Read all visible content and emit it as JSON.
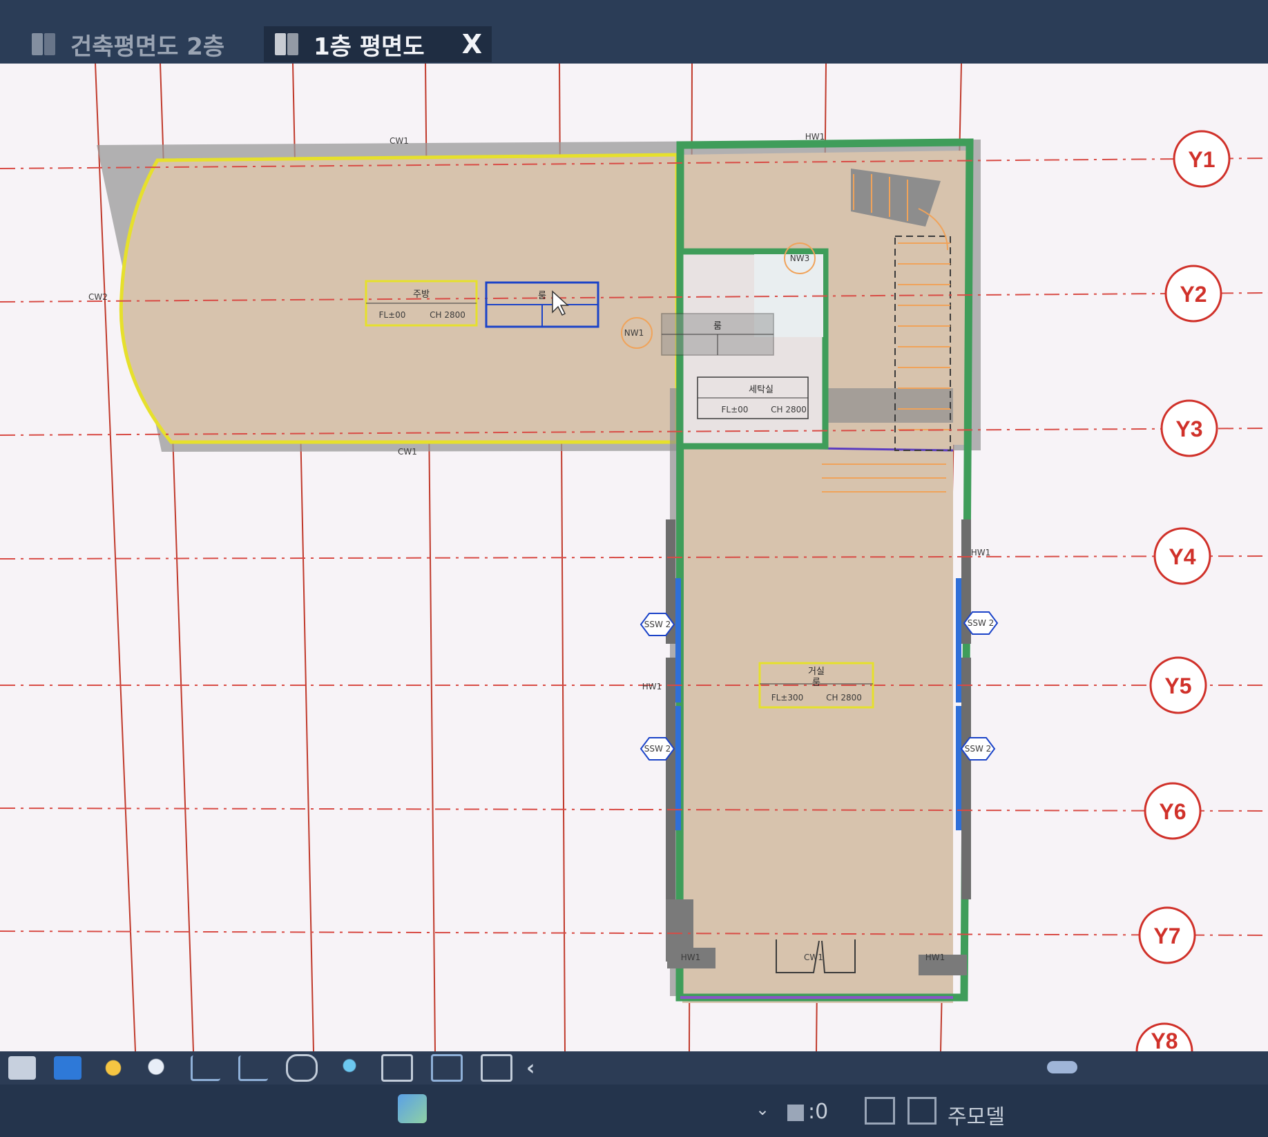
{
  "tabs": [
    {
      "label": "건축평면도 2층",
      "active": false
    },
    {
      "label": "1층 평면도",
      "active": true,
      "close": "X"
    }
  ],
  "grid_axes": [
    "Y1",
    "Y2",
    "Y3",
    "Y4",
    "Y5",
    "Y6",
    "Y7",
    "Y8"
  ],
  "rooms": {
    "kitchen": {
      "name": "주방",
      "fl": "FL±00",
      "ch": "CH 2800"
    },
    "room": {
      "name": "룸"
    },
    "laundry": {
      "name": "세탁실",
      "fl": "FL±00",
      "ch": "CH 2800"
    },
    "living": {
      "name": "거실",
      "sub": "룸",
      "fl": "FL±300",
      "ch": "CH 2800"
    }
  },
  "tags": {
    "window_top1": "CW1",
    "window_top2": "HW1",
    "window_left": "CW2",
    "window_bottom": "CW1",
    "door_nw1": "NW1",
    "door_nw2": "NW3",
    "hw_right": "HW1",
    "hw_left": "HW1",
    "ssw_left_1": "SSW 2",
    "ssw_right_1": "SSW 2",
    "ssw_left_2": "SSW 2",
    "ssw_right_2": "SSW 2",
    "bottom_left": "HW1",
    "bottom_door": "CW1",
    "bottom_right": "HW1"
  },
  "status": {
    "coord": ":0",
    "model": "주모델"
  },
  "toolbar_icons": [
    "box-icon",
    "cube-icon",
    "sun-icon",
    "shadow-icon",
    "crop-off-icon",
    "crop-icon",
    "glasses-icon",
    "bulb-icon",
    "hide-icon",
    "section-icon",
    "region-icon"
  ],
  "colors": {
    "floor": "#d7c3ad",
    "wall_green": "#3f9d5a",
    "outline_yellow": "#e6e02c",
    "grid_red": "#d0312a",
    "selection_blue": "#1b43c8"
  }
}
